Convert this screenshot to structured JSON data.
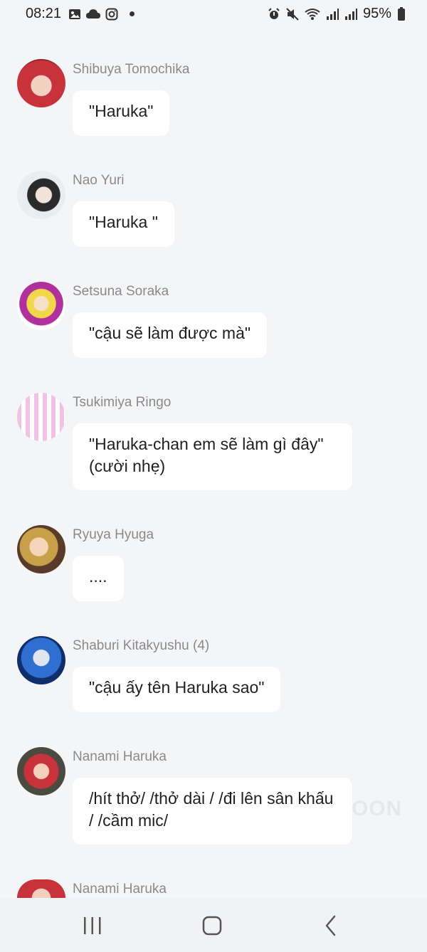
{
  "status_bar": {
    "time": "08:21",
    "battery": "95%",
    "left_icons": [
      "gallery-icon",
      "cloud-icon",
      "instagram-icon"
    ],
    "right_icons": [
      "alarm-icon",
      "mute-icon",
      "wifi-icon",
      "signal-icon",
      "signal-icon",
      "battery-icon"
    ]
  },
  "messages": [
    {
      "name": "Shibuya Tomochika",
      "text": "\"Haruka\""
    },
    {
      "name": "Nao Yuri",
      "text": "\"Haruka \""
    },
    {
      "name": "Setsuna Soraka",
      "text": "\"cậu sẽ làm được mà\""
    },
    {
      "name": "Tsukimiya Ringo",
      "text": "\"Haruka-chan em sẽ làm gì đây\" (cười nhẹ)"
    },
    {
      "name": "Ryuya Hyuga",
      "text": "...."
    },
    {
      "name": "Shaburi Kitakyushu (4)",
      "text": "\"cậu ấy tên Haruka sao\""
    },
    {
      "name": "Nanami Haruka",
      "text": "/hít thở/ /thở dài / /đi lên sân khấu / /cầm mic/"
    },
    {
      "name": "Nanami Haruka",
      "text": ""
    }
  ],
  "watermark": "OON",
  "nav": {
    "recent": "recent-apps-icon",
    "home": "home-icon",
    "back": "back-icon"
  },
  "colors": {
    "background": "#f4f5f7",
    "bubble": "#ffffff",
    "name": "#8a8a8a"
  }
}
